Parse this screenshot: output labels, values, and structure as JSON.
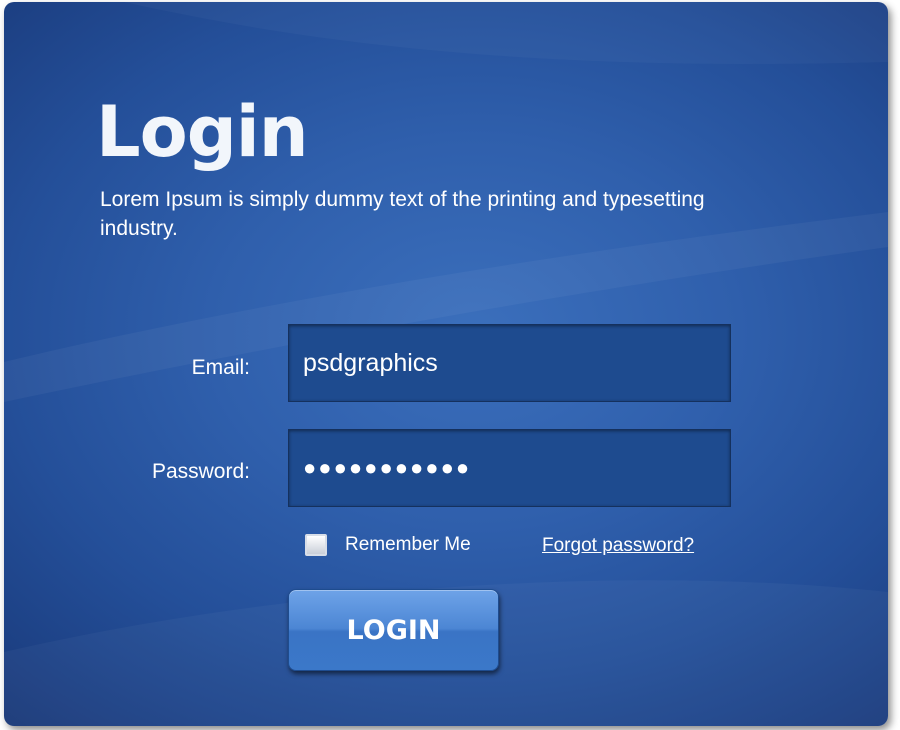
{
  "login_panel": {
    "title": "Login",
    "subtitle": "Lorem Ipsum is simply dummy text of the printing and typesetting industry.",
    "email": {
      "label": "Email:",
      "value": "psdgraphics"
    },
    "password": {
      "label": "Password:",
      "value": "●●●●●●●●●●●"
    },
    "remember_me": {
      "label": "Remember Me",
      "checked": false
    },
    "forgot_password_link": "Forgot password?",
    "login_button": "LOGIN"
  },
  "colors": {
    "panel_center": "#3b6fbc",
    "panel_edge": "#163571",
    "field_background": "#1e4b8f",
    "button_top": "#6ea3e8",
    "button_bottom": "#3b78c9",
    "text": "#ffffff"
  }
}
